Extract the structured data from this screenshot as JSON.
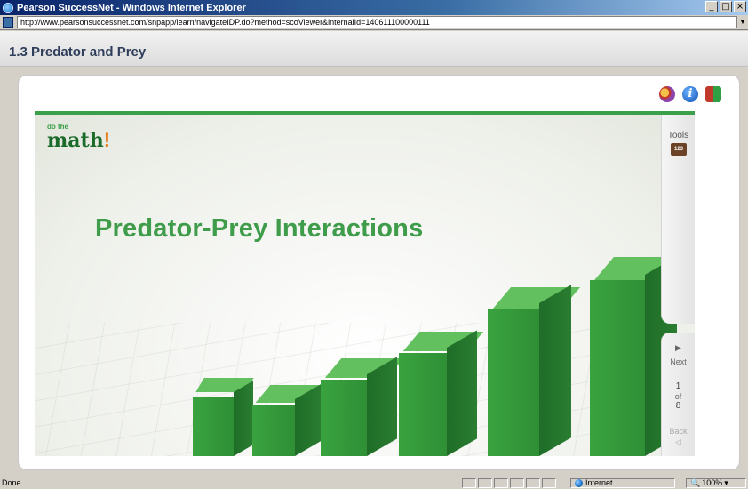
{
  "window": {
    "title": "Pearson SuccessNet - Windows Internet Explorer",
    "url": "http://www.pearsonsuccessnet.com/snpapp/learn/navigateIDP.do?method=scoViewer&internalId=140611100000111"
  },
  "page": {
    "title": "1.3  Predator and Prey"
  },
  "slide": {
    "logo_small": "do the",
    "logo_main": "math",
    "logo_bang": "!",
    "title": "Predator-Prey Interactions",
    "accent": "#3aa14a",
    "bar_color": "#34a03a"
  },
  "sidebar": {
    "tools_label": "Tools",
    "calc_label": "123",
    "next_label": "Next",
    "page_current": "1",
    "page_of": "of",
    "page_total": "8",
    "back_label": "Back"
  },
  "statusbar": {
    "status": "Done",
    "zone": "Internet",
    "zoom": "100%"
  }
}
